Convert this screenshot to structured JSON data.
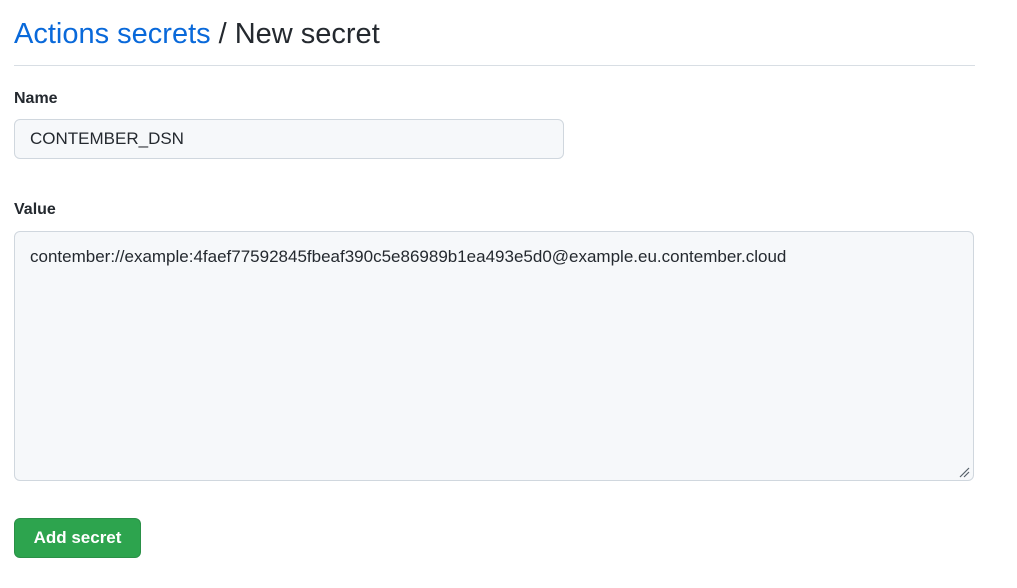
{
  "header": {
    "breadcrumb_link": "Actions secrets",
    "separator": "/",
    "current": "New secret"
  },
  "form": {
    "name_label": "Name",
    "name_value": "CONTEMBER_DSN",
    "value_label": "Value",
    "value_value": "contember://example:4faef77592845fbeaf390c5e86989b1ea493e5d0@example.eu.contember.cloud",
    "submit_label": "Add secret"
  },
  "colors": {
    "link": "#0969da",
    "text": "#24292f",
    "input_bg": "#f6f8fa",
    "border": "#d0d7de",
    "button_bg": "#2da44e",
    "button_text": "#ffffff"
  },
  "icons": {
    "resize": "resize-grip-icon"
  }
}
